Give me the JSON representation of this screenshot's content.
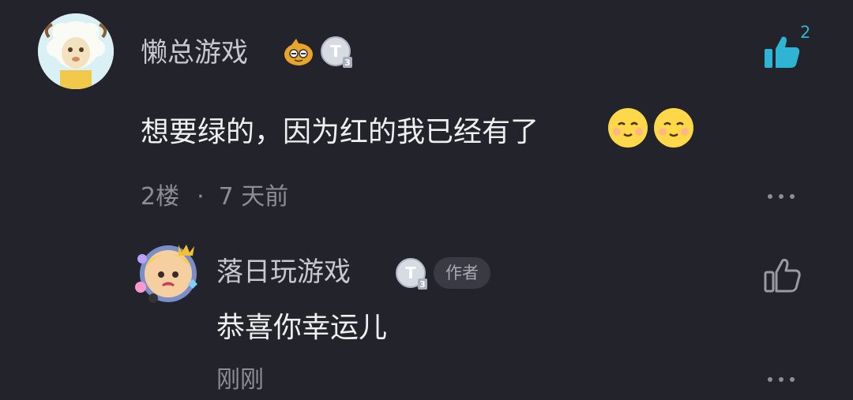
{
  "main_comment": {
    "username": "懒总游戏",
    "level_badge": "T3",
    "fan_badge_icon": "cartoon-face-badge-icon",
    "like_count": "2",
    "like_state": "liked",
    "text": "想要绿的，因为红的我已经有了",
    "emojis": [
      "smile-emoji",
      "smile-emoji"
    ],
    "floor": "2楼",
    "separator": "·",
    "time": "7 天前",
    "more_icon": "more-dots-icon"
  },
  "reply": {
    "username": "落日玩游戏",
    "level_badge": "T3",
    "author_tag": "作者",
    "text": "恭喜你幸运儿",
    "time": "刚刚",
    "like_state": "not-liked",
    "more_icon": "more-dots-icon"
  },
  "colors": {
    "background": "#23232b",
    "accent_like": "#2fb4d3",
    "secondary_text": "#8d8d95"
  }
}
